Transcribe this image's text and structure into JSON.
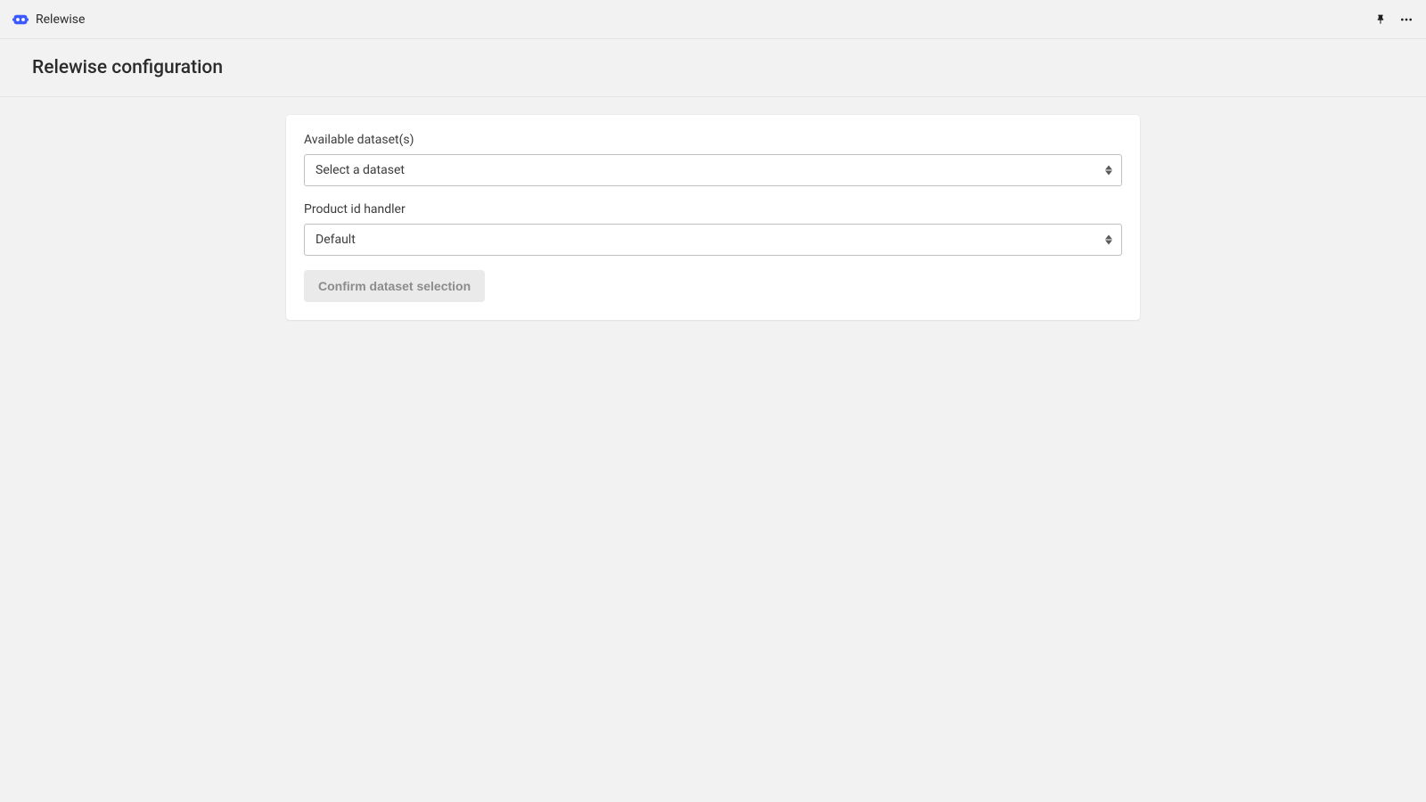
{
  "topbar": {
    "app_name": "Relewise"
  },
  "page": {
    "title": "Relewise configuration"
  },
  "form": {
    "dataset_label": "Available dataset(s)",
    "dataset_value": "Select a dataset",
    "handler_label": "Product id handler",
    "handler_value": "Default",
    "confirm_button_label": "Confirm dataset selection"
  }
}
